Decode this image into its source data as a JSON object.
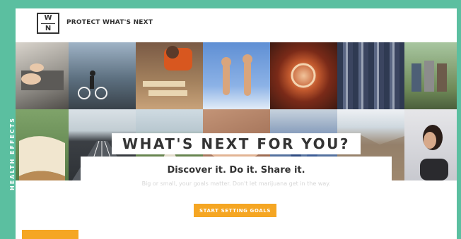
{
  "brand": {
    "logo_top": "W",
    "logo_bottom": "N",
    "name": "PROTECT WHAT'S NEXT"
  },
  "side_tab": {
    "label": "HEALTH EFFECTS"
  },
  "hero": {
    "headline": "WHAT'S NEXT FOR YOU?"
  },
  "card": {
    "title": "Discover it. Do it. Share it.",
    "subtitle": "Big or small, your goals matter. Don't let marijuana get in the way.",
    "cta_label": "START SETTING GOALS"
  },
  "colors": {
    "frame": "#5bbfa0",
    "accent": "#f5a623",
    "text": "#333333"
  }
}
